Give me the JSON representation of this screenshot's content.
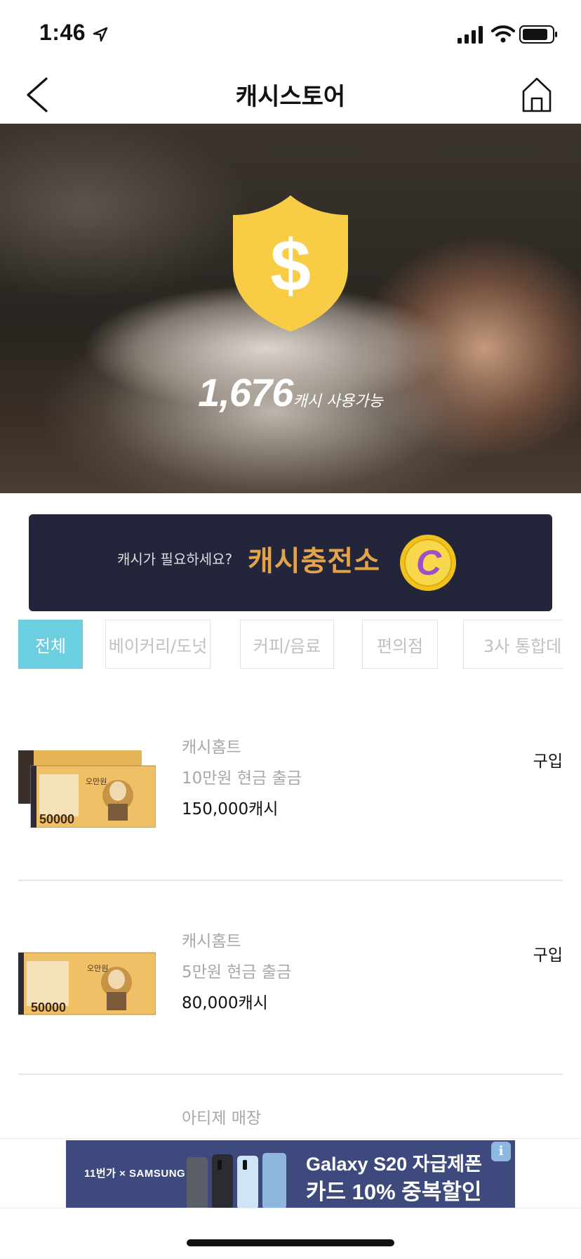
{
  "status_bar": {
    "time": "1:46"
  },
  "nav": {
    "title": "캐시스토어"
  },
  "hero": {
    "cash_amount": "1,676",
    "cash_suffix": "캐시 사용가능"
  },
  "charge_banner": {
    "question": "캐시가 필요하세요?",
    "title": "캐시충전소"
  },
  "tabs": [
    {
      "label": "전체",
      "active": true
    },
    {
      "label": "베이커리/도넛",
      "active": false
    },
    {
      "label": "커피/음료",
      "active": false
    },
    {
      "label": "편의점",
      "active": false
    },
    {
      "label": "3사 통합데",
      "active": false
    }
  ],
  "products": [
    {
      "brand": "캐시홈트",
      "name": "10만원 현금 출금",
      "price": "150,000캐시",
      "buy_label": "구입",
      "note_label": "50000",
      "note_text": "오만원"
    },
    {
      "brand": "캐시홈트",
      "name": "5만원 현금 출금",
      "price": "80,000캐시",
      "buy_label": "구입",
      "note_label": "50000",
      "note_text": "오만원"
    },
    {
      "brand": "아티제 매장",
      "name": "",
      "price": "",
      "buy_label": ""
    }
  ],
  "ad": {
    "brand": "11번가 × SAMSUNG",
    "line1": "Galaxy S20 자급제폰",
    "line2": "카드 10% 중복할인",
    "info_label": "i"
  },
  "colors": {
    "accent_tab": "#6ccfe0",
    "banner_bg": "#23253a",
    "charge_title": "#e3a34a",
    "shield": "#f8cd45",
    "ad_bg": "#3e4a7d"
  }
}
